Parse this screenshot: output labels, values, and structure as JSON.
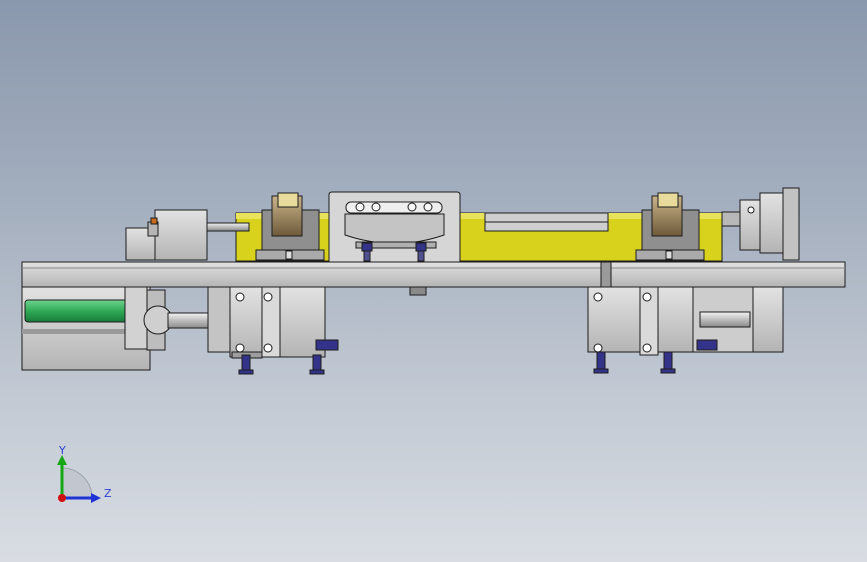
{
  "viewport": {
    "background_top": "#8a98ad",
    "background_bottom": "#d9dde3"
  },
  "model": {
    "colors": {
      "frame": "#c9c9c9",
      "plate_yellow": "#d8d21c",
      "cylinder_green": "#2faa55",
      "fitting_blue": "#33338a",
      "outline": "#1c1c1c"
    }
  },
  "triad": {
    "y_label": "Y",
    "z_label": "Z",
    "colors": {
      "y": "#14a814",
      "z": "#1f33d6",
      "origin": "#d01010"
    }
  }
}
